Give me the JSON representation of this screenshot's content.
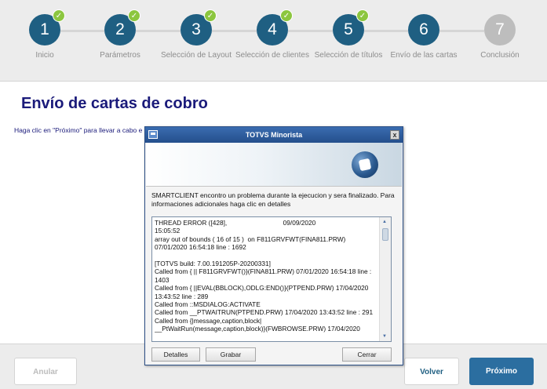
{
  "stepper": {
    "steps": [
      {
        "number": "1",
        "label": "Inicio",
        "completed": true
      },
      {
        "number": "2",
        "label": "Parámetros",
        "completed": true
      },
      {
        "number": "3",
        "label": "Selección de Layout",
        "completed": true
      },
      {
        "number": "4",
        "label": "Selección de clientes",
        "completed": true
      },
      {
        "number": "5",
        "label": "Selección de títulos",
        "completed": true
      },
      {
        "number": "6",
        "label": "Envío de las cartas",
        "completed": false
      },
      {
        "number": "7",
        "label": "Conclusión",
        "completed": false
      }
    ],
    "check_glyph": "✓",
    "colors": {
      "active": "#1f5f82",
      "pending": "#bdbdbd",
      "check": "#8cc63f"
    }
  },
  "page": {
    "title": "Envío de cartas de cobro",
    "hint": "Haga clic en \"Próximo\" para llevar a cabo e"
  },
  "dialog": {
    "title": "TOTVS Minorista",
    "close_glyph": "x",
    "message": "SMARTCLIENT encontro un problema durante la ejecucion y sera finalizado. Para informaciones adicionales haga clic en detalles",
    "log_lines": [
      "THREAD ERROR ([428],                               09/09/2020",
      "15:05:52",
      "array out of bounds ( 16 of 15 )  on F811GRVFWT(FINA811.PRW)",
      "07/01/2020 16:54:18 line : 1692",
      "",
      "[TOTVS build: 7.00.191205P-20200331]",
      "Called from { || F811GRVFWT()}(FINA811.PRW) 07/01/2020 16:54:18 line :",
      "1403",
      "Called from { ||EVAL(BBLOCK),ODLG:END()}(PTPEND.PRW) 17/04/2020",
      "13:43:52 line : 289",
      "Called from ::MSDIALOG:ACTIVATE",
      "Called from __PTWAITRUN(PTPEND.PRW) 17/04/2020 13:43:52 line : 291",
      "Called from {|message,caption,block|",
      "__PtWaitRun(message,caption,block)}(FWBROWSE.PRW) 17/04/2020"
    ],
    "buttons": {
      "details": "Detalles",
      "save": "Grabar",
      "close": "Cerrar"
    },
    "icons": {
      "app": "window-icon",
      "logo": "totvs-logo"
    }
  },
  "footer": {
    "cancel_label": "Anular",
    "back_label": "Volver",
    "next_label": "Próximo"
  },
  "colors": {
    "title": "#1a1a7a",
    "primary_button": "#2b6ea0",
    "dialog_titlebar": "#244f8c"
  }
}
